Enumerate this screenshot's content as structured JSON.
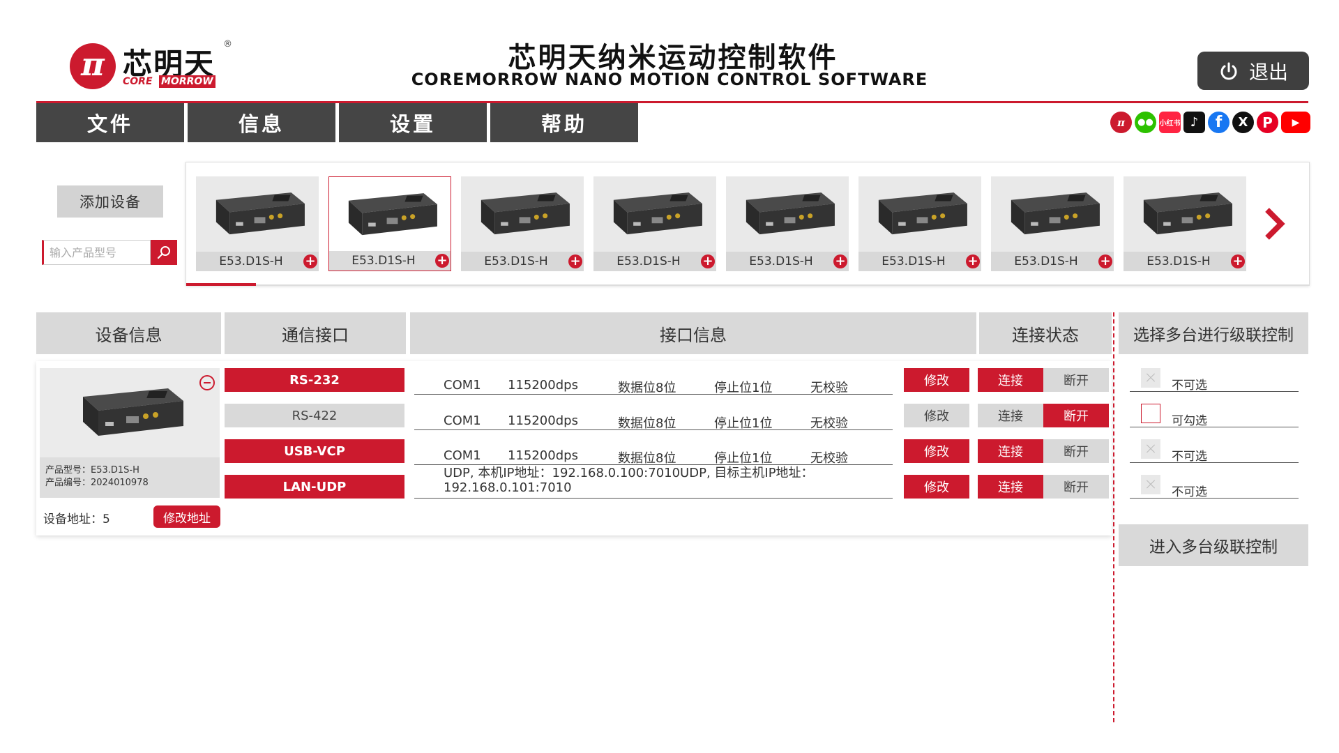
{
  "brand": {
    "logo_symbol": "π",
    "name_cn": "芯明天",
    "reg": "®",
    "name_en_core": "CORE",
    "name_en_morrow": "MORROW"
  },
  "title": {
    "cn": "芯明天纳米运动控制软件",
    "en": "COREMORROW NANO MOTION CONTROL SOFTWARE"
  },
  "exit": {
    "label": "退出"
  },
  "menu": [
    {
      "label": "文件"
    },
    {
      "label": "信息"
    },
    {
      "label": "设置"
    },
    {
      "label": "帮助"
    }
  ],
  "social": [
    {
      "icon": "coremorrow-icon",
      "glyph": "π"
    },
    {
      "icon": "wechat-icon",
      "glyph": "●●"
    },
    {
      "icon": "xiaohongshu-icon",
      "glyph": "小红书"
    },
    {
      "icon": "douyin-icon",
      "glyph": "♪"
    },
    {
      "icon": "facebook-icon",
      "glyph": "f"
    },
    {
      "icon": "x-icon",
      "glyph": "X"
    },
    {
      "icon": "pinterest-icon",
      "glyph": "P"
    },
    {
      "icon": "youtube-icon",
      "glyph": "▶"
    }
  ],
  "sidebar": {
    "add_device": "添加设备",
    "search_placeholder": "输入产品型号"
  },
  "carousel": {
    "items": [
      {
        "model": "E53.D1S-H",
        "selected": false
      },
      {
        "model": "E53.D1S-H",
        "selected": true
      },
      {
        "model": "E53.D1S-H",
        "selected": false
      },
      {
        "model": "E53.D1S-H",
        "selected": false
      },
      {
        "model": "E53.D1S-H",
        "selected": false
      },
      {
        "model": "E53.D1S-H",
        "selected": false
      },
      {
        "model": "E53.D1S-H",
        "selected": false
      },
      {
        "model": "E53.D1S-H",
        "selected": false
      }
    ]
  },
  "table": {
    "headers": {
      "device_info": "设备信息",
      "comm_interface": "通信接口",
      "interface_info": "接口信息",
      "conn_status": "连接状态"
    },
    "device": {
      "model_line": "产品型号：E53.D1S-H",
      "serial_line": "产品编号：2024010978",
      "address_label": "设备地址：5",
      "modify_address": "修改地址"
    },
    "rows": [
      {
        "interface": "RS-232",
        "active": true,
        "port": "COM1",
        "baud": "115200dps",
        "data_bits": "数据位8位",
        "stop_bits": "停止位1位",
        "parity": "无校验",
        "modify": "修改",
        "connect": "连接",
        "disconnect": "断开",
        "connected": true
      },
      {
        "interface": "RS-422",
        "active": false,
        "port": "COM1",
        "baud": "115200dps",
        "data_bits": "数据位8位",
        "stop_bits": "停止位1位",
        "parity": "无校验",
        "modify": "修改",
        "connect": "连接",
        "disconnect": "断开",
        "connected": false
      },
      {
        "interface": "USB-VCP",
        "active": true,
        "port": "COM1",
        "baud": "115200dps",
        "data_bits": "数据位8位",
        "stop_bits": "停止位1位",
        "parity": "无校验",
        "modify": "修改",
        "connect": "连接",
        "disconnect": "断开",
        "connected": true
      },
      {
        "interface": "LAN-UDP",
        "active": true,
        "info": "UDP, 本机IP地址：192.168.0.100:7010UDP, 目标主机IP地址：192.168.0.101:7010",
        "modify": "修改",
        "connect": "连接",
        "disconnect": "断开",
        "connected": true
      }
    ]
  },
  "cascade": {
    "title": "选择多台进行级联控制",
    "options": [
      {
        "label": "不可选",
        "enabled": false
      },
      {
        "label": "可勾选",
        "enabled": true
      },
      {
        "label": "不可选",
        "enabled": false
      },
      {
        "label": "不可选",
        "enabled": false
      }
    ],
    "enter_button": "进入多台级联控制"
  },
  "colors": {
    "accent": "#cc1a2e",
    "menu_bg": "#454545",
    "header_bg": "#d9d9d9"
  }
}
